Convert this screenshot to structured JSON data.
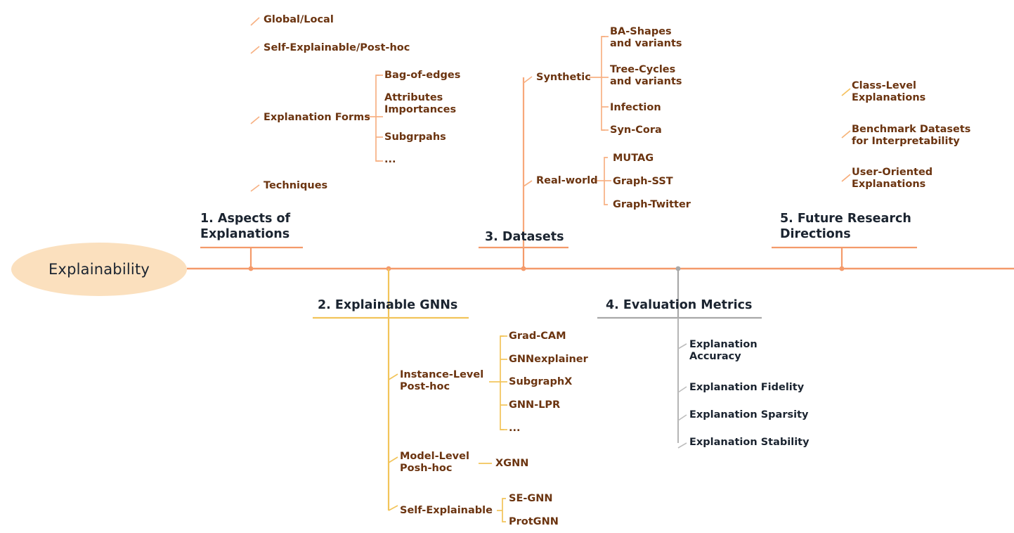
{
  "root": {
    "label": "Explainability",
    "fill": "#FBE0BE"
  },
  "colors": {
    "spine": "#F49A6A",
    "salmon": "#F49A6A",
    "gold": "#F2C45A",
    "gray": "#A8A8A8",
    "brown_text": "#6B3410",
    "navy_text": "#1b2430"
  },
  "sections": [
    {
      "id": "aspects",
      "heading": "1. Aspects of\nExplanations",
      "color": "#F49A6A",
      "children": [
        {
          "label": "Global/Local"
        },
        {
          "label": "Self-Explainable/Post-hoc"
        },
        {
          "label": "Explanation Forms",
          "children": [
            {
              "label": "Bag-of-edges"
            },
            {
              "label": "Attributes\nImportances"
            },
            {
              "label": "Subgrpahs"
            },
            {
              "label": "..."
            }
          ]
        },
        {
          "label": "Techniques"
        }
      ]
    },
    {
      "id": "explainable-gnns",
      "heading": "2. Explainable GNNs",
      "color": "#F2C45A",
      "children": [
        {
          "label": "Instance-Level\nPost-hoc",
          "children": [
            {
              "label": "Grad-CAM"
            },
            {
              "label": "GNNexplainer"
            },
            {
              "label": "SubgraphX"
            },
            {
              "label": "GNN-LPR"
            },
            {
              "label": "..."
            }
          ]
        },
        {
          "label": "Model-Level\nPosh-hoc",
          "children": [
            {
              "label": "XGNN"
            }
          ]
        },
        {
          "label": "Self-Explainable",
          "children": [
            {
              "label": "SE-GNN"
            },
            {
              "label": "ProtGNN"
            }
          ]
        }
      ]
    },
    {
      "id": "datasets",
      "heading": "3. Datasets",
      "color": "#F49A6A",
      "children": [
        {
          "label": "Synthetic",
          "children": [
            {
              "label": "BA-Shapes\nand variants"
            },
            {
              "label": "Tree-Cycles\nand variants"
            },
            {
              "label": "Infection"
            },
            {
              "label": "Syn-Cora"
            }
          ]
        },
        {
          "label": "Real-world",
          "children": [
            {
              "label": "MUTAG"
            },
            {
              "label": "Graph-SST"
            },
            {
              "label": "Graph-Twitter"
            }
          ]
        }
      ]
    },
    {
      "id": "evaluation-metrics",
      "heading": "4. Evaluation Metrics",
      "color": "#A8A8A8",
      "children": [
        {
          "label": "Explanation\nAccuracy"
        },
        {
          "label": "Explanation Fidelity"
        },
        {
          "label": "Explanation Sparsity"
        },
        {
          "label": "Explanation Stability"
        }
      ]
    },
    {
      "id": "future-research",
      "heading": "5. Future Research\nDirections",
      "color": "#F49A6A",
      "children": [
        {
          "label": "Class-Level\nExplanations"
        },
        {
          "label": "Benchmark Datasets\nfor Interpretability"
        },
        {
          "label": "User-Oriented\nExplanations"
        }
      ]
    }
  ]
}
